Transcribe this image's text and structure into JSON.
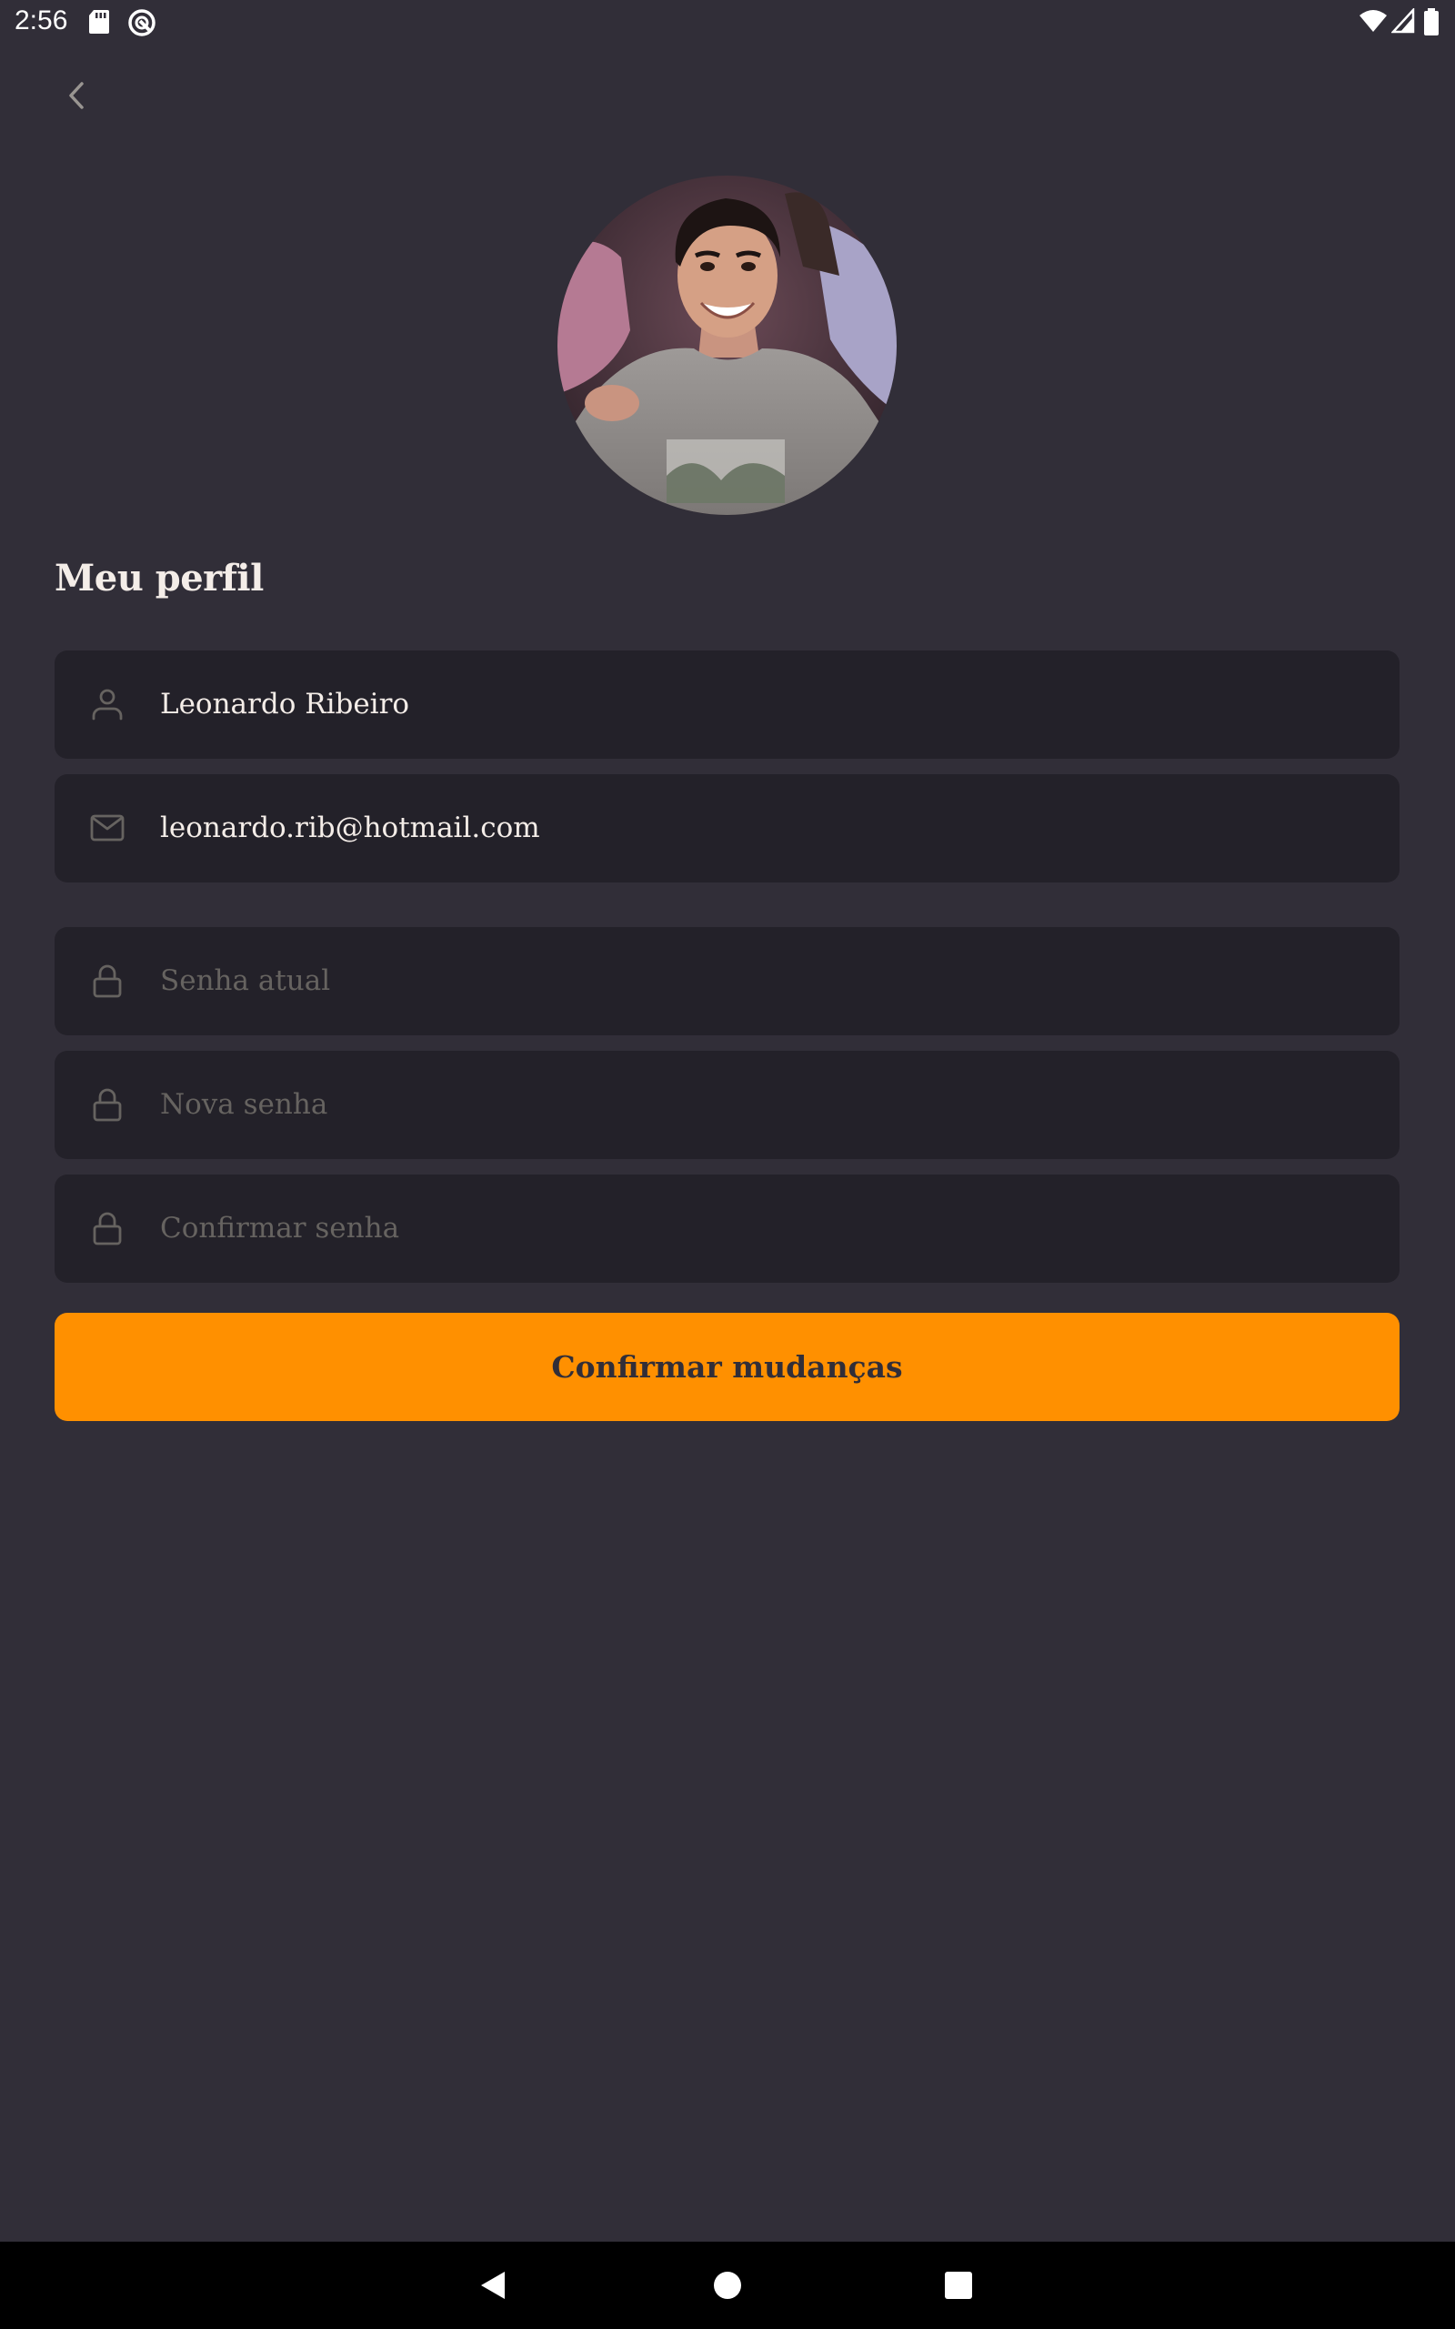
{
  "status_bar": {
    "time": "2:56",
    "icons": [
      "sd-card-icon",
      "sync-icon",
      "wifi-icon",
      "cellular-signal-icon",
      "battery-icon"
    ]
  },
  "header": {
    "back_icon": "chevron-left-icon"
  },
  "profile": {
    "title": "Meu perfil",
    "avatar_icon": "avatar"
  },
  "form": {
    "name": {
      "icon": "user-icon",
      "value": "Leonardo Ribeiro"
    },
    "email": {
      "icon": "mail-icon",
      "value": "leonardo.rib@hotmail.com"
    },
    "old_password": {
      "icon": "lock-icon",
      "placeholder": "Senha atual"
    },
    "new_password": {
      "icon": "lock-icon",
      "placeholder": "Nova senha"
    },
    "confirm_password": {
      "icon": "lock-icon",
      "placeholder": "Confirmar senha"
    },
    "submit_label": "Confirmar mudanças"
  },
  "nav_bar": {
    "icons": [
      "back-triangle-icon",
      "home-circle-icon",
      "recents-square-icon"
    ]
  },
  "colors": {
    "background": "#312e38",
    "input_background": "#232129",
    "accent": "#ff9000",
    "text": "#f4ede8",
    "placeholder": "#666360",
    "icon": "#666360"
  }
}
